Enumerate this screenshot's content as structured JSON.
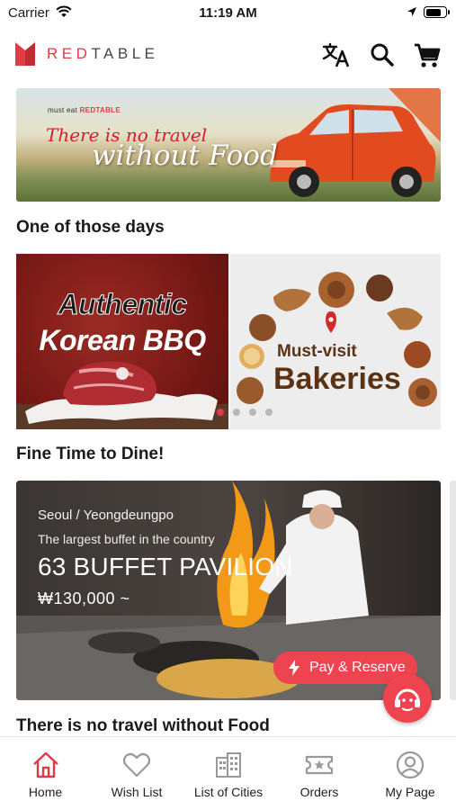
{
  "status_bar": {
    "carrier": "Carrier",
    "time": "11:19 AM",
    "battery_level": 0.8
  },
  "header": {
    "logo_red": "RED",
    "logo_rest": "TABLE"
  },
  "banner": {
    "tag_prefix": "must eat ",
    "tag_brand": "REDTABLE",
    "line1": "There is no travel",
    "line2": "without Food"
  },
  "sections": {
    "one_of_those_days": "One of those days",
    "fine_time": "Fine Time to Dine!",
    "no_travel": "There is no travel without Food"
  },
  "carousel": {
    "slides": [
      {
        "line1": "Authentic",
        "line2": "Korean BBQ"
      },
      {
        "line1": "Must-visit",
        "line2": "Bakeries"
      }
    ],
    "dot_count": 4,
    "active_dot": 0
  },
  "restaurant": {
    "location": "Seoul / Yeongdeungpo",
    "description": "The largest buffet in the country",
    "name": "63 BUFFET PAVILION",
    "price": "₩130,000 ~",
    "cta": "Pay & Reserve"
  },
  "tabs": [
    {
      "label": "Home",
      "icon": "home-icon",
      "active": true
    },
    {
      "label": "Wish List",
      "icon": "heart-icon",
      "active": false
    },
    {
      "label": "List of Cities",
      "icon": "city-icon",
      "active": false
    },
    {
      "label": "Orders",
      "icon": "ticket-icon",
      "active": false
    },
    {
      "label": "My Page",
      "icon": "user-icon",
      "active": false
    }
  ],
  "colors": {
    "accent": "#e03b45",
    "button": "#ee4450",
    "inactive_icon": "#999999"
  }
}
